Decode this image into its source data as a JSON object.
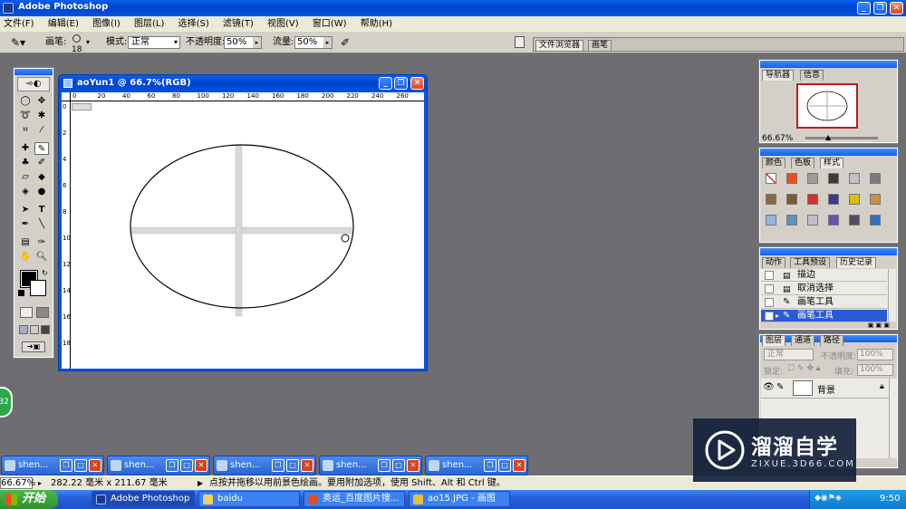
{
  "app": {
    "title": "Adobe Photoshop"
  },
  "menu": [
    "文件(F)",
    "编辑(E)",
    "图像(I)",
    "图层(L)",
    "选择(S)",
    "滤镜(T)",
    "视图(V)",
    "窗口(W)",
    "帮助(H)"
  ],
  "options": {
    "brush_label": "画笔:",
    "brush_size": "18",
    "mode_label": "模式:",
    "mode_value": "正常",
    "opacity_label": "不透明度:",
    "opacity_value": "50%",
    "flow_label": "流量:",
    "flow_value": "50%",
    "tabs": [
      "文件浏览器",
      "画笔"
    ]
  },
  "document": {
    "title": "aoYun1 @ 66.7%(RGB)",
    "h_ruler": [
      "0",
      "20",
      "40",
      "60",
      "80",
      "100",
      "120",
      "140",
      "160",
      "180",
      "200",
      "220",
      "240",
      "260"
    ],
    "v_ruler": [
      "0",
      "2",
      "4",
      "6",
      "8",
      "10",
      "12",
      "14",
      "16",
      "18"
    ]
  },
  "navigator": {
    "tabs": [
      "导航器",
      "信息"
    ],
    "zoom": "66.67%"
  },
  "swatches": {
    "tabs": [
      "颜色",
      "色板",
      "样式"
    ],
    "colors": [
      "#ffffff",
      "#e8501c",
      "#9c9c9c",
      "#3c3c3c",
      "#c0c0c0",
      "#7a7a7a",
      "#8a6a40",
      "#7c5a34",
      "#d03030",
      "#3a3a90",
      "#d8c000",
      "#c89040",
      "#90b8e0",
      "#6090c0",
      "#c0c0c8",
      "#7050b0",
      "#505060",
      "#3070c0"
    ]
  },
  "history": {
    "tabs": [
      "动作",
      "工具预设",
      "历史记录"
    ],
    "items": [
      "描边",
      "取消选择",
      "画笔工具",
      "画笔工具"
    ]
  },
  "layers": {
    "tabs": [
      "图层",
      "通道",
      "路径"
    ],
    "blend": "正常",
    "opacity_label": "不透明度:",
    "opacity": "100%",
    "lock_label": "锁定:",
    "fill_label": "填充:",
    "fill": "100%",
    "layer_name": "背景"
  },
  "minimized_docs": [
    "shen...",
    "shen...",
    "shen...",
    "shen...",
    "shen..."
  ],
  "status": {
    "zoom": "66.67%",
    "size": "282.22 毫米 x 211.67 毫米",
    "hint": "点按并拖移以用前景色绘画。要用附加选项，使用 Shift、Alt 和 Ctrl 键。"
  },
  "taskbar": {
    "start": "开始",
    "items": [
      "Adobe Photoshop",
      "baidu",
      "奥运_百度图片搜...",
      "ao15.JPG - 画图"
    ],
    "clock": "9:50"
  },
  "badge": "32",
  "watermark": {
    "title": "溜溜自学",
    "url": "ZIXUE.3D66.COM"
  }
}
